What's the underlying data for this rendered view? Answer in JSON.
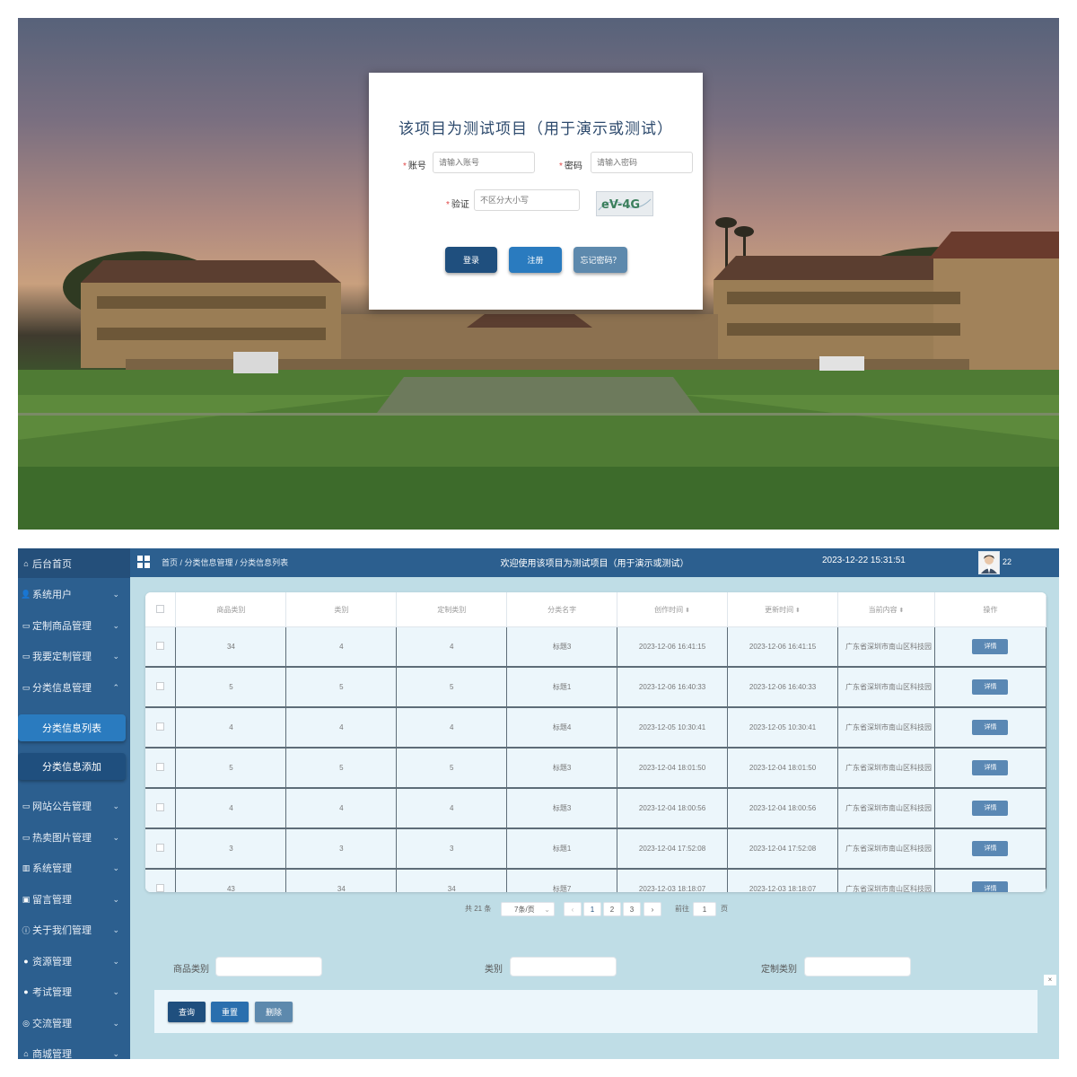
{
  "login": {
    "title": "该项目为测试项目（用于演示或测试）",
    "account_label": "账号",
    "account_placeholder": "请输入账号",
    "password_label": "密码",
    "password_placeholder": "请输入密码",
    "captcha_label": "验证",
    "captcha_placeholder": "不区分大小写",
    "captcha_text": "eV-4G",
    "buttons": {
      "login": "登录",
      "register": "注册",
      "forgot": "忘记密码？"
    },
    "colors": {
      "login": "#1f4f7e",
      "register": "#2a7bbf",
      "forgot": "#5d89ad"
    }
  },
  "admin": {
    "sidebar": {
      "home": "后台首页",
      "items": [
        {
          "label": "系统用户",
          "icon": "user-icon",
          "glyph": "👤",
          "expanded": false
        },
        {
          "label": "定制商品管理",
          "icon": "folder-icon",
          "glyph": "▭",
          "expanded": false
        },
        {
          "label": "我要定制管理",
          "icon": "folder-icon",
          "glyph": "▭",
          "expanded": false
        },
        {
          "label": "分类信息管理",
          "icon": "folder-icon",
          "glyph": "▭",
          "expanded": true
        },
        {
          "label": "网站公告管理",
          "icon": "folder-icon",
          "glyph": "▭",
          "expanded": false
        },
        {
          "label": "热卖图片管理",
          "icon": "folder-icon",
          "glyph": "▭",
          "expanded": false
        },
        {
          "label": "系统管理",
          "icon": "chart-icon",
          "glyph": "▥",
          "expanded": false
        },
        {
          "label": "留言管理",
          "icon": "image-icon",
          "glyph": "▣",
          "expanded": false
        },
        {
          "label": "关于我们管理",
          "icon": "info-icon",
          "glyph": "ⓘ",
          "expanded": false
        },
        {
          "label": "资源管理",
          "icon": "dot-icon",
          "glyph": "●",
          "expanded": false
        },
        {
          "label": "考试管理",
          "icon": "dot-icon",
          "glyph": "●",
          "expanded": false
        },
        {
          "label": "交流管理",
          "icon": "chat-icon",
          "glyph": "◎",
          "expanded": false
        },
        {
          "label": "商城管理",
          "icon": "cart-icon",
          "glyph": "⌂",
          "expanded": false
        }
      ],
      "submenu": [
        "分类信息列表",
        "分类信息添加"
      ]
    },
    "topbar": {
      "breadcrumb": [
        "首页",
        "分类信息管理",
        "分类信息列表"
      ],
      "welcome": "欢迎使用该项目为测试项目（用于演示或测试）",
      "time": "2023-12-22 15:31:51",
      "username": "22"
    },
    "table": {
      "headers": [
        "商品类别",
        "类别",
        "定制类别",
        "分类名字",
        "创作时间",
        "更新时间",
        "当前内容",
        "操作"
      ],
      "sortable": [
        false,
        false,
        false,
        false,
        true,
        true,
        true,
        false
      ],
      "rows": [
        [
          "34",
          "4",
          "4",
          "标题3",
          "2023-12-06 16:41:15",
          "2023-12-06 16:41:15",
          "广东省深圳市南山区科技园"
        ],
        [
          "5",
          "5",
          "5",
          "标题1",
          "2023-12-06 16:40:33",
          "2023-12-06 16:40:33",
          "广东省深圳市南山区科技园"
        ],
        [
          "4",
          "4",
          "4",
          "标题4",
          "2023-12-05 10:30:41",
          "2023-12-05 10:30:41",
          "广东省深圳市南山区科技园"
        ],
        [
          "5",
          "5",
          "5",
          "标题3",
          "2023-12-04 18:01:50",
          "2023-12-04 18:01:50",
          "广东省深圳市南山区科技园"
        ],
        [
          "4",
          "4",
          "4",
          "标题3",
          "2023-12-04 18:00:56",
          "2023-12-04 18:00:56",
          "广东省深圳市南山区科技园"
        ],
        [
          "3",
          "3",
          "3",
          "标题1",
          "2023-12-04 17:52:08",
          "2023-12-04 17:52:08",
          "广东省深圳市南山区科技园"
        ],
        [
          "43",
          "34",
          "34",
          "标题7",
          "2023-12-03 18:18:07",
          "2023-12-03 18:18:07",
          "广东省深圳市南山区科技园"
        ]
      ],
      "detail_label": "详情"
    },
    "pagination": {
      "total": "共 21 条",
      "page_size": "7条/页",
      "prev": "‹",
      "pages": [
        "1",
        "2",
        "3"
      ],
      "next": "›",
      "goto": "前往",
      "current": "1",
      "unit": "页"
    },
    "search": {
      "fields": [
        "商品类别",
        "类别",
        "定制类别"
      ],
      "buttons": {
        "query": "查询",
        "reset": "重置",
        "delete": "删除"
      },
      "colors": {
        "query": "#1f4f7e",
        "reset": "#2a6fae",
        "delete": "#5d89ad"
      }
    },
    "close_glyph": "×"
  }
}
